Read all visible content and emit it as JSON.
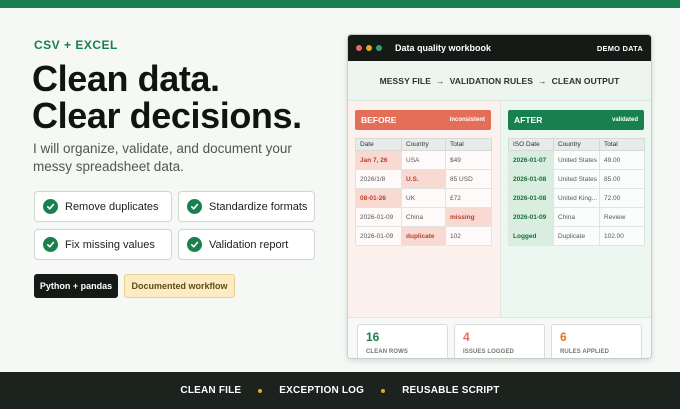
{
  "brand": {
    "green": "#18804e",
    "dark": "#151a17",
    "red": "#e46e58",
    "orange": "#e0761f",
    "amber": "#e3a81f"
  },
  "hero": {
    "eyebrow": "CSV + EXCEL",
    "headline_1": "Clean data.",
    "headline_2": "Clear decisions.",
    "subhead": "I will organize, validate, and document your messy spreadsheet data."
  },
  "features": [
    {
      "label": "Remove duplicates",
      "icon": "check-icon"
    },
    {
      "label": "Standardize formats",
      "icon": "check-icon"
    },
    {
      "label": "Fix missing values",
      "icon": "check-icon"
    },
    {
      "label": "Validation report",
      "icon": "check-icon"
    }
  ],
  "tags": {
    "primary": "Python + pandas",
    "secondary": "Documented workflow"
  },
  "window": {
    "title": "Data quality workbook",
    "badge": "DEMO DATA",
    "flow": {
      "step1": "MESSY FILE",
      "step2": "VALIDATION RULES",
      "step3": "CLEAN OUTPUT",
      "arrow": "→"
    },
    "before": {
      "heading": "BEFORE",
      "tag": "inconsistent",
      "columns": [
        "Date",
        "Country",
        "Total"
      ],
      "rows": [
        [
          "Jan 7, 26",
          "USA",
          "$49"
        ],
        [
          "2026/1/8",
          "U.S.",
          "85 USD"
        ],
        [
          "08-01-26",
          "UK",
          "£72"
        ],
        [
          "2026-01-09",
          "China",
          "missing"
        ],
        [
          "2026-01-09",
          "duplicate",
          "102"
        ]
      ]
    },
    "after": {
      "heading": "AFTER",
      "tag": "validated",
      "columns": [
        "ISO Date",
        "Country",
        "Total"
      ],
      "rows": [
        [
          "2026-01-07",
          "United States",
          "49.00"
        ],
        [
          "2026-01-08",
          "United States",
          "85.00"
        ],
        [
          "2026-01-08",
          "United King...",
          "72.00"
        ],
        [
          "2026-01-09",
          "China",
          "Review"
        ],
        [
          "Logged",
          "Duplicate",
          "102.00"
        ]
      ]
    },
    "stats": [
      {
        "value": "16",
        "label": "CLEAN ROWS"
      },
      {
        "value": "4",
        "label": "ISSUES LOGGED"
      },
      {
        "value": "6",
        "label": "RULES APPLIED"
      }
    ]
  },
  "footer": {
    "item1": "CLEAN FILE",
    "item2": "EXCEPTION LOG",
    "item3": "REUSABLE SCRIPT"
  }
}
